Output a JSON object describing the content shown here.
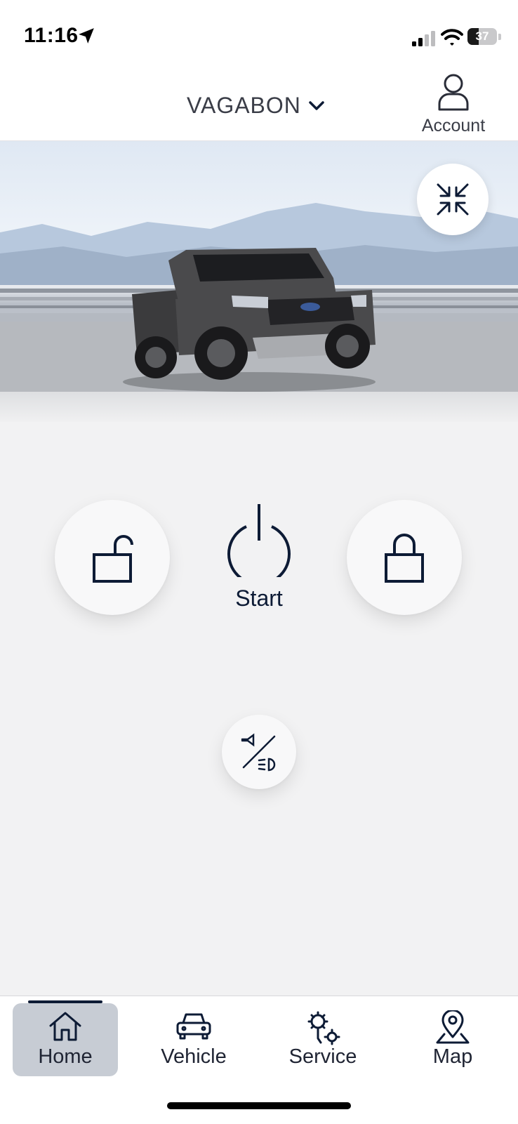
{
  "status_bar": {
    "time": "11:16",
    "battery_percent": "37",
    "battery_level": 0.37
  },
  "header": {
    "vehicle_name": "VAGABON",
    "account_label": "Account"
  },
  "controls": {
    "start_label": "Start"
  },
  "tabs": [
    {
      "label": "Home",
      "icon": "home-icon",
      "active": true
    },
    {
      "label": "Vehicle",
      "icon": "car-icon",
      "active": false
    },
    {
      "label": "Service",
      "icon": "wrench-gear-icon",
      "active": false
    },
    {
      "label": "Map",
      "icon": "map-pin-icon",
      "active": false
    }
  ],
  "colors": {
    "primary": "#0d1b35",
    "tab_active_bg": "#c7ccd4",
    "background": "#f2f2f3"
  }
}
